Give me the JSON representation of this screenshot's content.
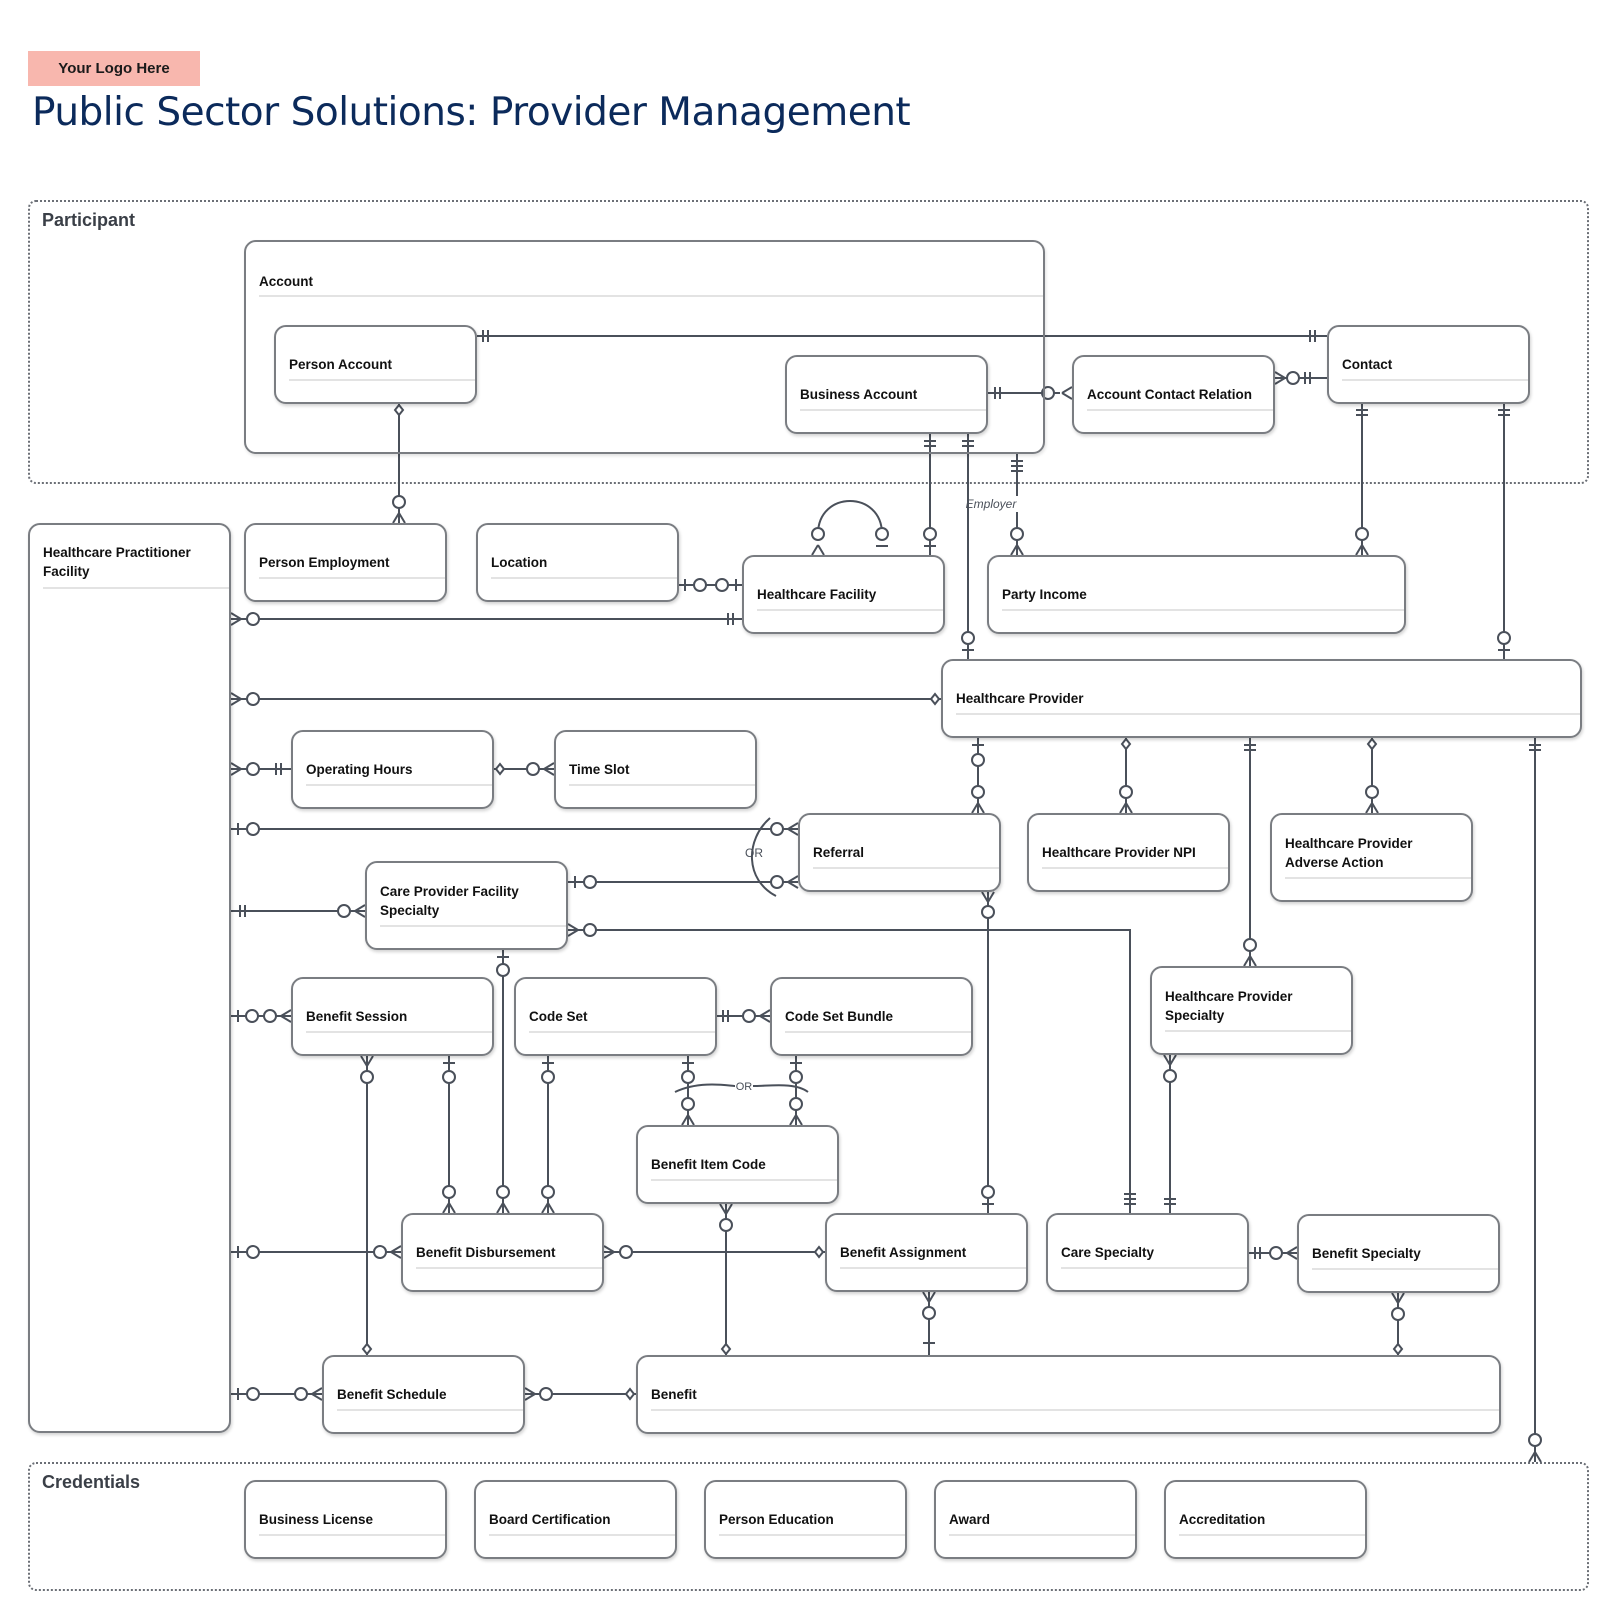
{
  "header": {
    "logo_text": "Your Logo Here",
    "title": "Public Sector Solutions: Provider Management"
  },
  "groups": {
    "participant": "Participant",
    "credentials": "Credentials"
  },
  "entities": {
    "account": "Account",
    "person_account": "Person Account",
    "business_account": "Business Account",
    "account_contact_relation": "Account Contact Relation",
    "contact": "Contact",
    "healthcare_practitioner_facility": "Healthcare Practitioner Facility",
    "person_employment": "Person Employment",
    "location": "Location",
    "healthcare_facility": "Healthcare Facility",
    "party_income": "Party Income",
    "healthcare_provider": "Healthcare Provider",
    "operating_hours": "Operating Hours",
    "time_slot": "Time Slot",
    "referral": "Referral",
    "healthcare_provider_npi": "Healthcare Provider NPI",
    "healthcare_provider_adverse_action": "Healthcare Provider Adverse Action",
    "care_provider_facility_specialty": "Care Provider Facility Specialty",
    "healthcare_provider_specialty": "Healthcare Provider Specialty",
    "benefit_session": "Benefit Session",
    "code_set": "Code Set",
    "code_set_bundle": "Code Set Bundle",
    "benefit_item_code": "Benefit Item Code",
    "benefit_disbursement": "Benefit Disbursement",
    "benefit_assignment": "Benefit Assignment",
    "care_specialty": "Care Specialty",
    "benefit_specialty": "Benefit Specialty",
    "benefit_schedule": "Benefit Schedule",
    "benefit": "Benefit",
    "business_license": "Business License",
    "board_certification": "Board Certification",
    "person_education": "Person Education",
    "award": "Award",
    "accreditation": "Accreditation"
  },
  "labels": {
    "employer": "Employer",
    "or": "OR"
  }
}
